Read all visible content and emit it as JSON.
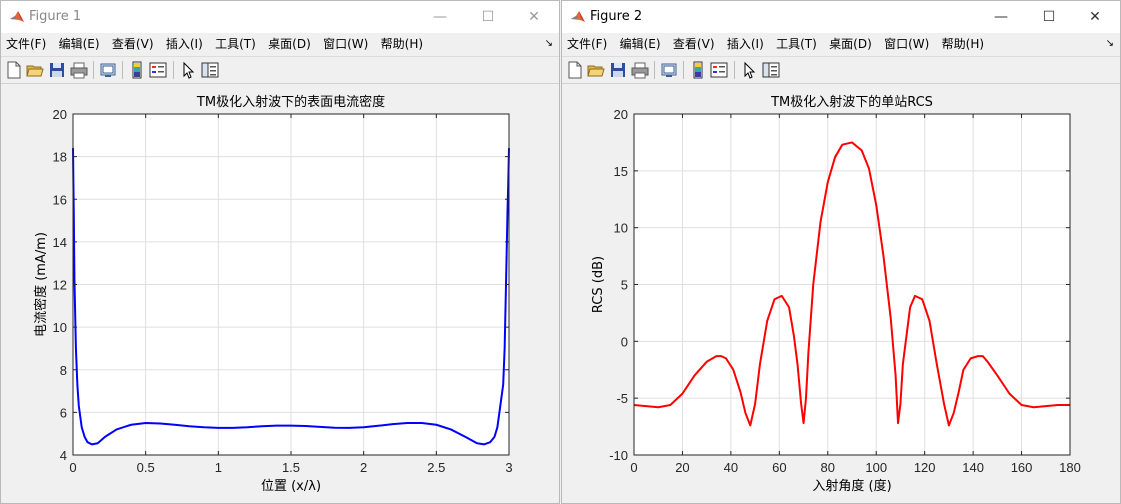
{
  "windows": [
    {
      "title": "Figure 1",
      "active": false,
      "controls": {
        "minimize": "—",
        "maximize": "☐",
        "close": "✕"
      },
      "menu": [
        "文件(F)",
        "编辑(E)",
        "查看(V)",
        "插入(I)",
        "工具(T)",
        "桌面(D)",
        "窗口(W)",
        "帮助(H)"
      ],
      "menu_arrow": "↘",
      "toolbar_icons": [
        "new-figure-icon",
        "open-file-icon",
        "save-icon",
        "print-icon",
        "link-icon",
        "colorbar-icon",
        "legend-icon",
        "pointer-icon",
        "property-inspector-icon"
      ]
    },
    {
      "title": "Figure 2",
      "active": true,
      "controls": {
        "minimize": "—",
        "maximize": "☐",
        "close": "✕"
      },
      "menu": [
        "文件(F)",
        "编辑(E)",
        "查看(V)",
        "插入(I)",
        "工具(T)",
        "桌面(D)",
        "窗口(W)",
        "帮助(H)"
      ],
      "menu_arrow": "↘",
      "toolbar_icons": [
        "new-figure-icon",
        "open-file-icon",
        "save-icon",
        "print-icon",
        "link-icon",
        "colorbar-icon",
        "legend-icon",
        "pointer-icon",
        "property-inspector-icon"
      ]
    }
  ],
  "chart_data": [
    {
      "type": "line",
      "title": "TM极化入射波下的表面电流密度",
      "xlabel": "位置 (x/λ)",
      "ylabel": "电流密度 (mA/m)",
      "xlim": [
        0,
        3
      ],
      "ylim": [
        4,
        20
      ],
      "xticks": [
        0,
        0.5,
        1,
        1.5,
        2,
        2.5,
        3
      ],
      "yticks": [
        4,
        6,
        8,
        10,
        12,
        14,
        16,
        18,
        20
      ],
      "grid": true,
      "color": "#0000ff",
      "x": [
        0,
        0.005,
        0.01,
        0.02,
        0.03,
        0.04,
        0.06,
        0.08,
        0.1,
        0.13,
        0.17,
        0.22,
        0.3,
        0.4,
        0.5,
        0.6,
        0.7,
        0.8,
        0.9,
        1.0,
        1.1,
        1.2,
        1.3,
        1.4,
        1.5,
        1.6,
        1.7,
        1.8,
        1.9,
        2.0,
        2.1,
        2.2,
        2.3,
        2.4,
        2.5,
        2.6,
        2.7,
        2.78,
        2.83,
        2.87,
        2.9,
        2.92,
        2.94,
        2.96,
        2.97,
        2.98,
        2.99,
        2.995,
        3.0
      ],
      "values": [
        18.4,
        15.5,
        12.2,
        9.0,
        7.3,
        6.3,
        5.3,
        4.85,
        4.6,
        4.5,
        4.55,
        4.85,
        5.2,
        5.42,
        5.5,
        5.48,
        5.42,
        5.35,
        5.3,
        5.27,
        5.27,
        5.3,
        5.35,
        5.38,
        5.38,
        5.36,
        5.32,
        5.28,
        5.27,
        5.3,
        5.37,
        5.45,
        5.5,
        5.5,
        5.42,
        5.2,
        4.85,
        4.55,
        4.5,
        4.6,
        4.85,
        5.3,
        6.3,
        7.3,
        9.0,
        12.2,
        15.5,
        16.8,
        18.4
      ]
    },
    {
      "type": "line",
      "title": "TM极化入射波下的单站RCS",
      "xlabel": "入射角度 (度)",
      "ylabel": "RCS (dB)",
      "xlim": [
        0,
        180
      ],
      "ylim": [
        -10,
        20
      ],
      "xticks": [
        0,
        20,
        40,
        60,
        80,
        100,
        120,
        140,
        160,
        180
      ],
      "yticks": [
        -10,
        -5,
        0,
        5,
        10,
        15,
        20
      ],
      "grid": true,
      "color": "#ff0000",
      "x": [
        0,
        5,
        10,
        15,
        20,
        25,
        30,
        34,
        36,
        38,
        41,
        44,
        46,
        48,
        50,
        52,
        55,
        58,
        61,
        64,
        66,
        67.5,
        69,
        70,
        71,
        72,
        74,
        77,
        80,
        83,
        86,
        90,
        94,
        97,
        100,
        103,
        106,
        108,
        109,
        110,
        111,
        112.5,
        114,
        116,
        119,
        122,
        125,
        128,
        130,
        132,
        134,
        136,
        139,
        142,
        144,
        146,
        150,
        155,
        160,
        165,
        170,
        175,
        180
      ],
      "values": [
        -5.6,
        -5.7,
        -5.8,
        -5.6,
        -4.6,
        -3.0,
        -1.8,
        -1.3,
        -1.3,
        -1.5,
        -2.5,
        -4.5,
        -6.3,
        -7.4,
        -5.5,
        -2.0,
        1.8,
        3.7,
        4.0,
        3.0,
        0.5,
        -2.0,
        -5.5,
        -7.2,
        -5.0,
        -1.0,
        5.0,
        10.5,
        14.0,
        16.2,
        17.3,
        17.5,
        16.8,
        15.2,
        12.0,
        7.5,
        2.0,
        -3.0,
        -7.2,
        -5.5,
        -2.0,
        0.5,
        3.0,
        4.0,
        3.7,
        1.8,
        -2.0,
        -5.5,
        -7.4,
        -6.3,
        -4.5,
        -2.5,
        -1.5,
        -1.3,
        -1.3,
        -1.8,
        -3.0,
        -4.6,
        -5.6,
        -5.8,
        -5.7,
        -5.6,
        -5.6
      ]
    }
  ]
}
